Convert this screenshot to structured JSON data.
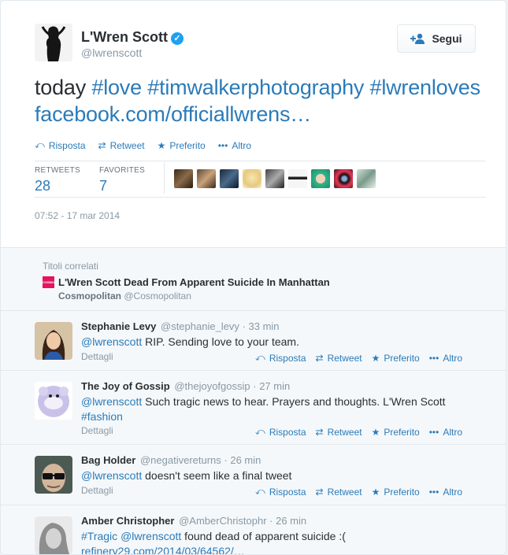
{
  "main_tweet": {
    "name": "L'Wren Scott",
    "handle": "@lwrenscott",
    "follow_label": "Segui",
    "text": {
      "word": "today",
      "tag1": "#love",
      "tag2": "#timwalkerphotography",
      "tag3": "#lwrenloves",
      "link": "facebook.com/officiallwrens…"
    },
    "actions": {
      "reply": "Risposta",
      "retweet": "Retweet",
      "favorite": "Preferito",
      "more": "Altro"
    },
    "stats": {
      "retweets_label": "RETWEETS",
      "retweets_value": "28",
      "favorites_label": "FAVORITES",
      "favorites_value": "7"
    },
    "timestamp": "07:52 - 17 mar 2014"
  },
  "related": {
    "title": "Titoli correlati",
    "logo_text": "COSMO",
    "headline": "L'Wren Scott Dead From Apparent Suicide In Manhattan",
    "source_name": "Cosmopolitan",
    "source_handle": "@Cosmopolitan"
  },
  "reply_labels": {
    "details": "Dettagli",
    "reply": "Risposta",
    "retweet": "Retweet",
    "favorite": "Preferito",
    "more": "Altro"
  },
  "replies": [
    {
      "name": "Stephanie Levy",
      "handle": "@stephanie_levy",
      "time": "· 33 min",
      "mention": "@lwrenscott",
      "text": " RIP. Sending love to your team."
    },
    {
      "name": "The Joy of Gossip",
      "handle": "@thejoyofgossip",
      "time": "· 27 min",
      "mention": "@lwrenscott",
      "text": " Such tragic news to hear.  Prayers and thoughts.  L'Wren Scott ",
      "tag": "#fashion"
    },
    {
      "name": "Bag Holder",
      "handle": "@negativereturns",
      "time": "· 26 min",
      "mention": "@lwrenscott",
      "text": " doesn't seem like a final tweet"
    },
    {
      "name": "Amber Christopher",
      "handle": "@AmberChristophr",
      "time": "· 26 min",
      "tag": "#Tragic",
      "mention": "@lwrenscott",
      "text": " found dead of apparent suicide :(",
      "link": "refinery29.com/2014/03/64562/…"
    }
  ],
  "colors": {
    "link": "#2b7bb9",
    "text": "#292f33",
    "muted": "#8899a6",
    "verified": "#1da1f2",
    "cosmopolitan": "#e4145d"
  },
  "icons": [
    "verified-icon",
    "follow-person-icon",
    "reply-icon",
    "retweet-icon",
    "star-icon",
    "more-dots-icon"
  ]
}
